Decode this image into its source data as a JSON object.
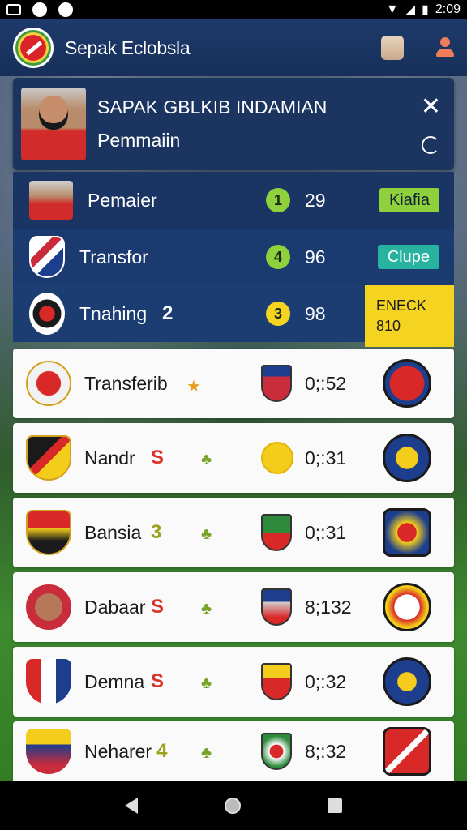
{
  "status_bar": {
    "time": "2:09"
  },
  "app": {
    "title": "Sepak Eclobsla"
  },
  "player_card": {
    "name": "SAPAK GBLKIB INDAMIAN",
    "role": "Pemmaiin",
    "close_label": "✕"
  },
  "dark_rows": [
    {
      "label": "Pemaier",
      "badge": "1",
      "badge_color": "#8fd13c",
      "score": "29",
      "tag": "Kiafia",
      "tag_color": "#8fd13c"
    },
    {
      "label": "Transfor",
      "badge": "4",
      "badge_color": "#8fd13c",
      "score": "96",
      "tag": "Clupe",
      "tag_color": "#27b3a0"
    },
    {
      "label": "Tnahing",
      "big_number": "2",
      "badge": "3",
      "badge_color": "#f5d321",
      "score": "98",
      "tag_line1": "ENECK",
      "tag_line2": "810",
      "tag_color": "#f5d321"
    }
  ],
  "list_items": [
    {
      "name": "Transferib",
      "extra": "",
      "score": "0;:52"
    },
    {
      "name": "Nandr",
      "extra": "S",
      "score": "0;:31"
    },
    {
      "name": "Bansia",
      "extra": "3",
      "score": "0;:31"
    },
    {
      "name": "Dabaar",
      "extra": "S",
      "score": "8;132"
    },
    {
      "name": "Demna",
      "extra": "S",
      "score": "0;:32"
    },
    {
      "name": "Neharer",
      "extra": "4",
      "score": "8;:32"
    }
  ]
}
